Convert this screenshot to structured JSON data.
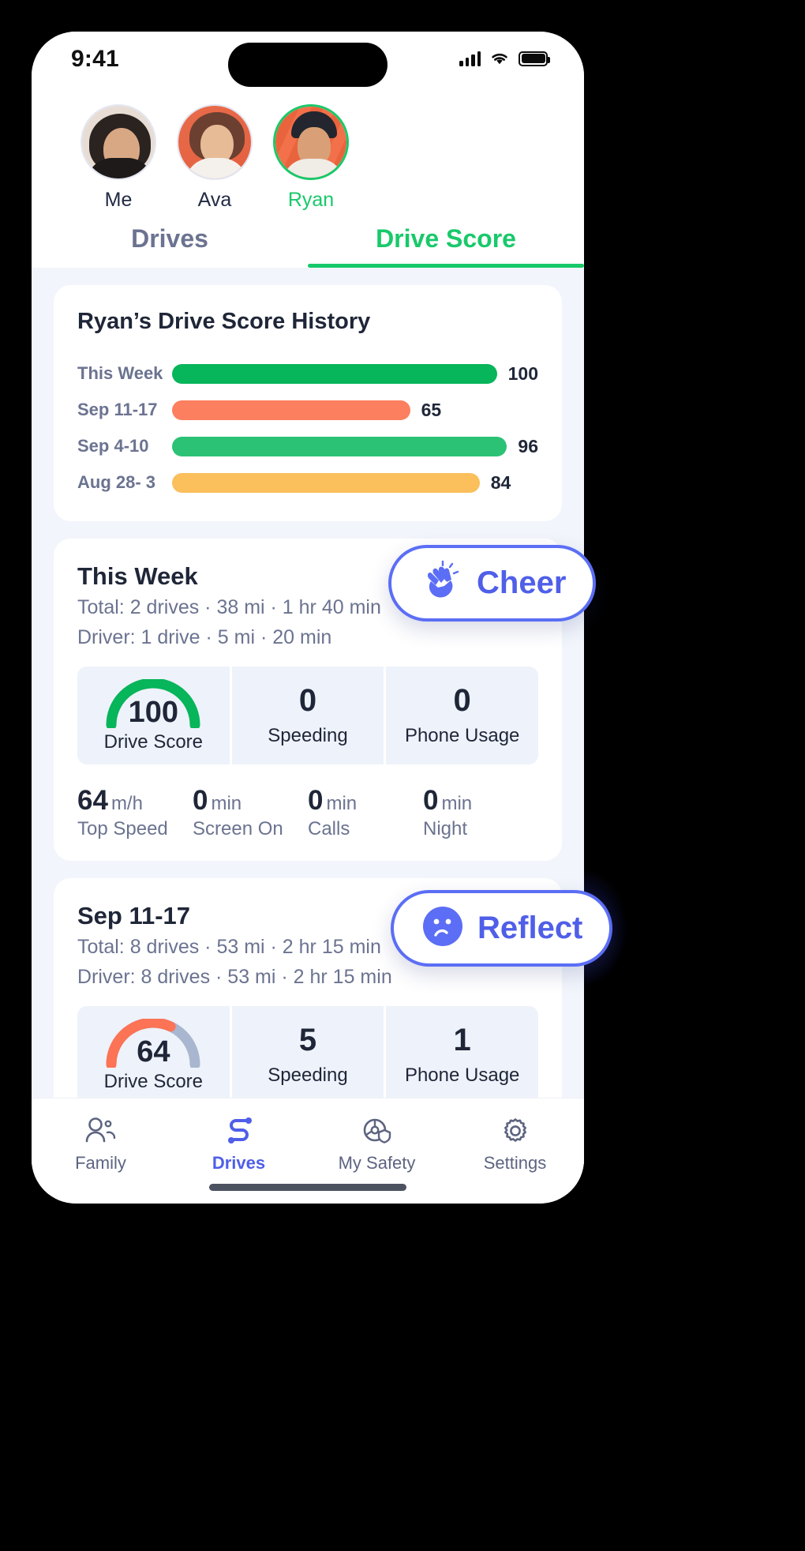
{
  "status_bar": {
    "time": "9:41",
    "icons": [
      "cellular-signal-icon",
      "wifi-icon",
      "battery-icon"
    ]
  },
  "people": [
    {
      "name": "Me",
      "active": false
    },
    {
      "name": "Ava",
      "active": false
    },
    {
      "name": "Ryan",
      "active": true
    }
  ],
  "tabs": [
    {
      "label": "Drives",
      "active": false
    },
    {
      "label": "Drive Score",
      "active": true
    }
  ],
  "history_card": {
    "title": "Ryan’s Drive Score History"
  },
  "chart_data": {
    "type": "bar",
    "title": "Ryan’s Drive Score History",
    "orientation": "horizontal",
    "categories": [
      "This Week",
      "Sep 11-17",
      "Sep 4-10",
      "Aug 28- 3"
    ],
    "values": [
      100,
      65,
      96,
      84
    ],
    "labels": [
      "100",
      "65",
      "96",
      "84"
    ],
    "colors": [
      "#07b55a",
      "#fc7f5f",
      "#2bc275",
      "#fbbf5c"
    ],
    "xlabel": "",
    "ylabel": "",
    "xlim": [
      0,
      100
    ],
    "grid": false,
    "legend": false
  },
  "week_cards": [
    {
      "title": "This Week",
      "total_line": "Total: 2 drives · 38 mi · 1 hr 40 min",
      "driver_line": "Driver: 1 drive · 5 mi · 20 min",
      "tiles": [
        {
          "value": "100",
          "label": "Drive Score",
          "gauge": true,
          "gauge_percent": 100,
          "gauge_color": "#07b55a"
        },
        {
          "value": "0",
          "label": "Speeding",
          "gauge": false
        },
        {
          "value": "0",
          "label": "Phone Usage",
          "gauge": false
        }
      ],
      "metrics": [
        {
          "value": "64",
          "unit": "m/h",
          "label": "Top Speed"
        },
        {
          "value": "0",
          "unit": "min",
          "label": "Screen On"
        },
        {
          "value": "0",
          "unit": "min",
          "label": "Calls"
        },
        {
          "value": "0",
          "unit": "min",
          "label": "Night"
        }
      ]
    },
    {
      "title": "Sep 11-17",
      "total_line": "Total: 8 drives · 53 mi · 2 hr 15 min",
      "driver_line": "Driver: 8 drives · 53 mi · 2 hr 15 min",
      "tiles": [
        {
          "value": "64",
          "label": "Drive Score",
          "gauge": true,
          "gauge_percent": 64,
          "gauge_color": "#fc7356"
        },
        {
          "value": "5",
          "label": "Speeding",
          "gauge": false
        },
        {
          "value": "1",
          "label": "Phone Usage",
          "gauge": false
        }
      ]
    }
  ],
  "floating_buttons": [
    {
      "label": "Cheer",
      "icon": "clapping-hands-icon",
      "color": "#4f5fe8"
    },
    {
      "label": "Reflect",
      "icon": "sad-face-icon",
      "color": "#4f5fe8"
    }
  ],
  "bottom_nav": [
    {
      "label": "Family",
      "icon": "people-icon",
      "active": false
    },
    {
      "label": "Drives",
      "icon": "route-icon",
      "active": true
    },
    {
      "label": "My Safety",
      "icon": "steering-wheel-shield-icon",
      "active": false
    },
    {
      "label": "Settings",
      "icon": "gear-icon",
      "active": false
    }
  ],
  "colors": {
    "accent_green": "#18c96a",
    "accent_blue": "#4f5fe8",
    "bg": "#f2f5fb",
    "text_dark": "#1f2638",
    "text_muted": "#6b7390"
  }
}
